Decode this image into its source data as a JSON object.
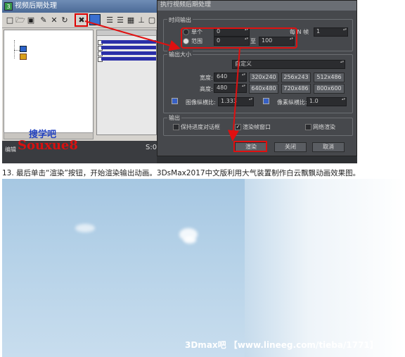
{
  "video_post": {
    "title": "视频后期处理",
    "toolbar_icons": [
      "new-icon",
      "open-icon",
      "save-icon",
      "edit-icon",
      "delete-icon",
      "swap-icon",
      "execute-sequence-icon",
      "edit-range-bar-icon",
      "align-left-icon",
      "align-right-icon",
      "make-same-size-icon",
      "abut-icon",
      "add-scene-icon"
    ],
    "watermark_cn": "搜学吧",
    "watermark_en": "Souxue8",
    "status_label": "编辑",
    "status_s": "S:0"
  },
  "dialog": {
    "title": "执行视频后期处理",
    "time_output": {
      "group_label": "时间输出",
      "single_label": "单个",
      "single_value": "0",
      "every_n_label": "每 N 帧",
      "every_n_value": "1",
      "range_label": "范围",
      "range_from": "0",
      "range_to_label": "至",
      "range_to": "100"
    },
    "output_size": {
      "group_label": "输出大小",
      "preset": "自定义",
      "width_label": "宽度:",
      "width_value": "640",
      "height_label": "高度:",
      "height_value": "480",
      "presets": [
        "320x240",
        "256x243",
        "512x486",
        "640x480",
        "720x486",
        "800x600"
      ],
      "aspect_label": "图像纵横比:",
      "aspect_value": "1.333",
      "pixel_aspect_label": "像素纵横比:",
      "pixel_aspect_value": "1.0"
    },
    "output": {
      "group_label": "输出",
      "keep_progress_label": "保持进度对话框",
      "render_frame_label": "渲染帧窗口",
      "net_render_label": "网络渲染"
    },
    "buttons": {
      "render": "渲染",
      "close": "关闭",
      "cancel": "取消"
    }
  },
  "caption": "13. 最后单击“渲染”按钮，开始渲染输出动画。3DsMax2017中文版利用大气装置制作白云飘飘动画效果图。",
  "footer_watermark": "3Dmax吧 【www.lineeg.com/tieba/1771】",
  "colors": {
    "highlight_red": "#e01010",
    "dialog_bg": "#46484c",
    "sky_blue": "#a6c7e2"
  }
}
